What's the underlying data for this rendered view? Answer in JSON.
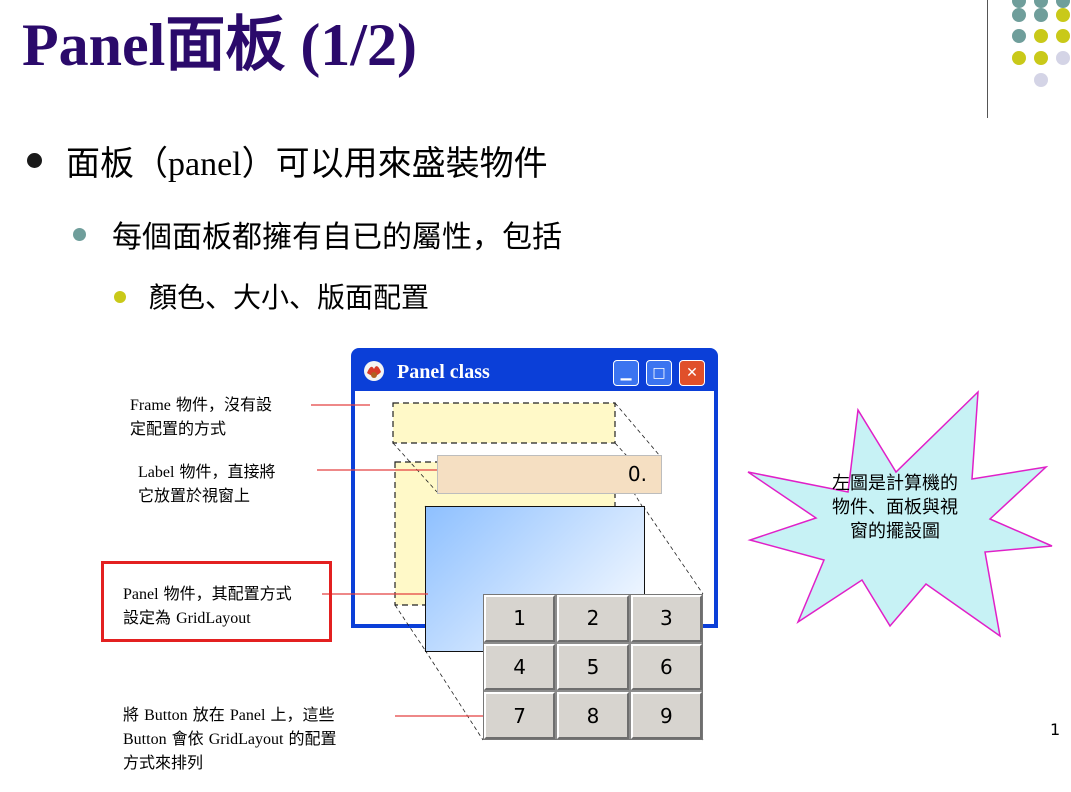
{
  "slide": {
    "title": "Panel面板 (1/2)",
    "page_number": "1"
  },
  "bullets": {
    "level1": {
      "pre": "面板（",
      "latin": "panel",
      "post": "）可以用來盛裝物件"
    },
    "level2": "每個面板都擁有自已的屬性，包括",
    "level3": "顏色、大小、版面配置"
  },
  "window": {
    "title": "Panel class",
    "display_value": "0."
  },
  "keypad": [
    "1",
    "2",
    "3",
    "4",
    "5",
    "6",
    "7",
    "8",
    "9"
  ],
  "annotations": {
    "frame": {
      "line1_latin": "Frame",
      "line1_rest": " 物件，沒有設",
      "line2": "定配置的方式"
    },
    "label": {
      "line1_latin": "Label",
      "line1_rest": " 物件，直接將",
      "line2": "它放置於視窗上"
    },
    "panel": {
      "line1_latin": "Panel",
      "line1_rest": " 物件，其配置方式",
      "line2_pre": "設定為 ",
      "line2_latin": "GridLayout"
    },
    "button": {
      "line1_a": "將 ",
      "line1_b": "Button",
      "line1_c": " 放在 ",
      "line1_d": "Panel",
      "line1_e": " 上，這些",
      "line2_a": "Button",
      "line2_b": " 會依 ",
      "line2_c": "GridLayout",
      "line2_d": " 的配置",
      "line3": "方式來排列"
    }
  },
  "callout": {
    "lines": [
      "左圖是計算機的",
      "物件、面板與視",
      "窗的擺設圖"
    ]
  },
  "colors": {
    "title": "#2b0a6b",
    "bullet1": "#1a1a1a",
    "bullet2": "#6f9e9b",
    "bullet3": "#c9c919",
    "callout_fill": "#c7f2f5",
    "callout_stroke": "#e020c8",
    "annotation_box": "#e32020"
  }
}
